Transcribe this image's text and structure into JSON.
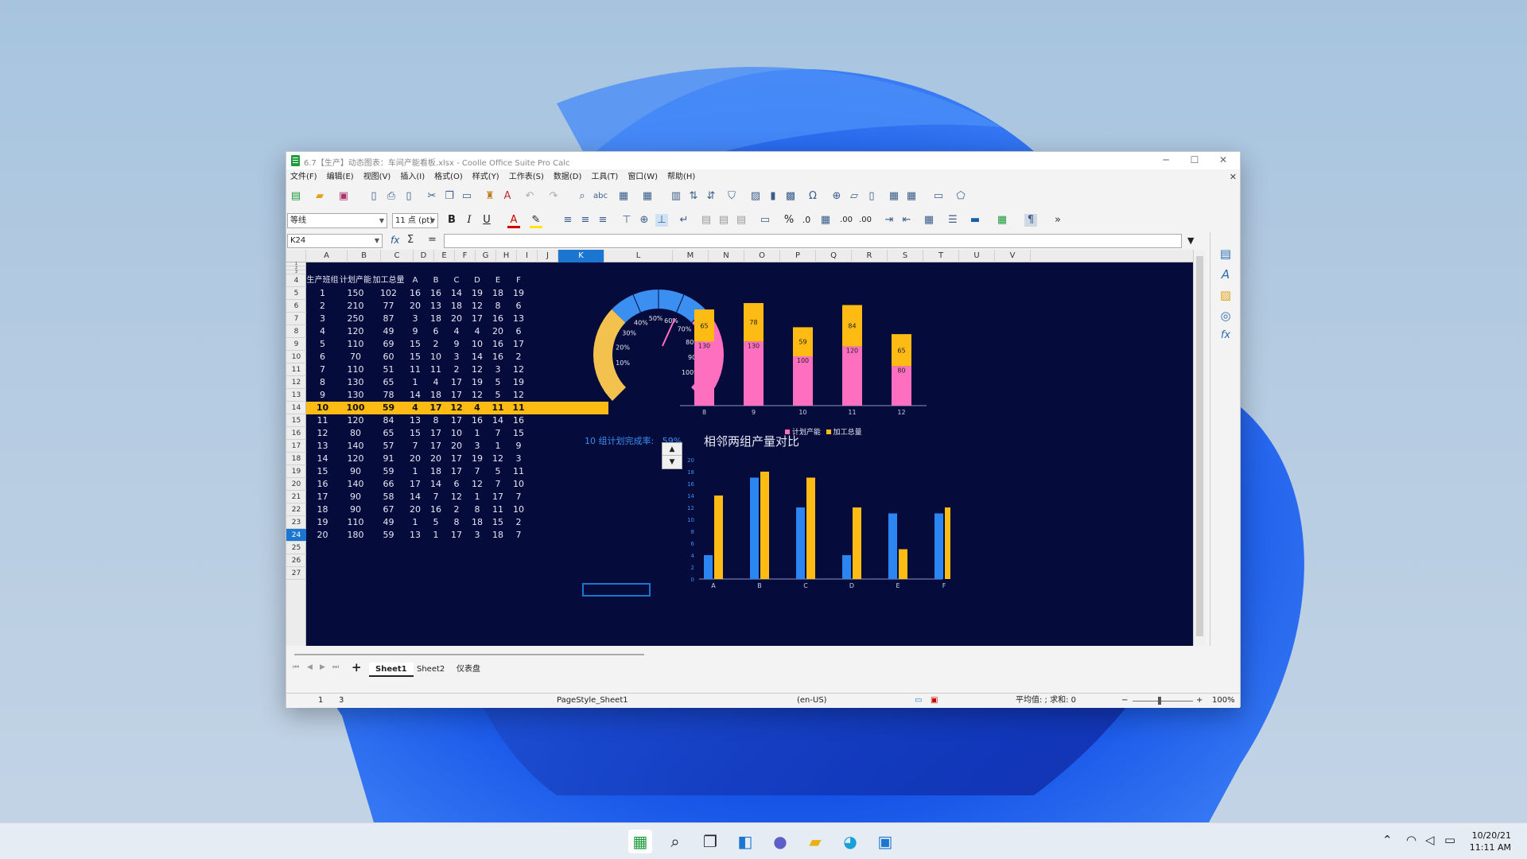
{
  "window": {
    "title": "6.7【生产】动态图表：车间产能看板.xlsx - Coolle Office Suite Pro Calc",
    "menu": [
      "文件(F)",
      "编辑(E)",
      "视图(V)",
      "插入(I)",
      "格式(O)",
      "样式(Y)",
      "工作表(S)",
      "数据(D)",
      "工具(T)",
      "窗口(W)",
      "帮助(H)"
    ]
  },
  "toolbar": {
    "font_name": "等线",
    "font_size": "11 点 (pt)",
    "bold": "B",
    "italic": "I",
    "underline": "U",
    "percent": "%",
    "decimal_zero": ".0",
    "dec_add": ".00",
    "dec_remove": ".00"
  },
  "formula_bar": {
    "name_box": "K24",
    "fx": "fx",
    "sigma": "Σ",
    "equals": "="
  },
  "columns": [
    "A",
    "B",
    "C",
    "D",
    "E",
    "F",
    "G",
    "H",
    "I",
    "J",
    "K",
    "L",
    "M",
    "N",
    "O",
    "P",
    "Q",
    "R",
    "S",
    "T",
    "U",
    "V"
  ],
  "rows": [
    "1",
    "2",
    "3",
    "4",
    "5",
    "6",
    "7",
    "8",
    "9",
    "10",
    "11",
    "12",
    "13",
    "14",
    "15",
    "16",
    "17",
    "18",
    "19",
    "20",
    "21",
    "22",
    "23",
    "24",
    "25",
    "26",
    "27"
  ],
  "table": {
    "header": [
      "生产班组",
      "计划产能",
      "加工总量",
      "A",
      "B",
      "C",
      "D",
      "E",
      "F"
    ],
    "data": [
      [
        "1",
        "150",
        "102",
        "16",
        "16",
        "14",
        "19",
        "18",
        "19"
      ],
      [
        "2",
        "210",
        "77",
        "20",
        "13",
        "18",
        "12",
        "8",
        "6"
      ],
      [
        "3",
        "250",
        "87",
        "3",
        "18",
        "20",
        "17",
        "16",
        "13"
      ],
      [
        "4",
        "120",
        "49",
        "9",
        "6",
        "4",
        "4",
        "20",
        "6"
      ],
      [
        "5",
        "110",
        "69",
        "15",
        "2",
        "9",
        "10",
        "16",
        "17"
      ],
      [
        "6",
        "70",
        "60",
        "15",
        "10",
        "3",
        "14",
        "16",
        "2"
      ],
      [
        "7",
        "110",
        "51",
        "11",
        "11",
        "2",
        "12",
        "3",
        "12"
      ],
      [
        "8",
        "130",
        "65",
        "1",
        "4",
        "17",
        "19",
        "5",
        "19"
      ],
      [
        "9",
        "130",
        "78",
        "14",
        "18",
        "17",
        "12",
        "5",
        "12"
      ],
      [
        "10",
        "100",
        "59",
        "4",
        "17",
        "12",
        "4",
        "11",
        "11"
      ],
      [
        "11",
        "120",
        "84",
        "13",
        "8",
        "17",
        "16",
        "14",
        "16"
      ],
      [
        "12",
        "80",
        "65",
        "15",
        "17",
        "10",
        "1",
        "7",
        "15"
      ],
      [
        "13",
        "140",
        "57",
        "7",
        "17",
        "20",
        "3",
        "1",
        "9"
      ],
      [
        "14",
        "120",
        "91",
        "20",
        "20",
        "17",
        "19",
        "12",
        "3"
      ],
      [
        "15",
        "90",
        "59",
        "1",
        "18",
        "17",
        "7",
        "5",
        "11"
      ],
      [
        "16",
        "140",
        "66",
        "17",
        "14",
        "6",
        "12",
        "7",
        "10"
      ],
      [
        "17",
        "90",
        "58",
        "14",
        "7",
        "12",
        "1",
        "17",
        "7"
      ],
      [
        "18",
        "90",
        "67",
        "20",
        "16",
        "2",
        "8",
        "11",
        "10"
      ],
      [
        "19",
        "110",
        "49",
        "1",
        "5",
        "8",
        "18",
        "15",
        "2"
      ],
      [
        "20",
        "180",
        "59",
        "13",
        "1",
        "17",
        "3",
        "18",
        "7"
      ]
    ],
    "highlighted_group": "10"
  },
  "chart_data": [
    {
      "type": "gauge",
      "title": "10 组计划完成率:   59%",
      "value": 0.59,
      "tick_labels": [
        "10%",
        "20%",
        "30%",
        "40%",
        "50%",
        "60%",
        "70%",
        "80%",
        "90%",
        "100%"
      ],
      "colors": {
        "low": "#f2c14e",
        "mid": "#3a8ff0",
        "high": "#ff6fc0"
      }
    },
    {
      "type": "bar",
      "stacked": true,
      "categories": [
        "8",
        "9",
        "10",
        "11",
        "12"
      ],
      "series": [
        {
          "name": "计划产能",
          "values": [
            130,
            130,
            100,
            120,
            80
          ],
          "color": "#ff6fc0"
        },
        {
          "name": "加工总量",
          "values": [
            65,
            78,
            59,
            84,
            65
          ],
          "color": "#fdbb14"
        }
      ]
    },
    {
      "type": "bar",
      "title": "相邻两组产量对比",
      "categories": [
        "A",
        "B",
        "C",
        "D",
        "E",
        "F"
      ],
      "series": [
        {
          "values": [
            4,
            17,
            12,
            4,
            11,
            11
          ],
          "color": "#2c86f2"
        },
        {
          "values": [
            14,
            18,
            17,
            12,
            5,
            12
          ],
          "color": "#fdbb14"
        }
      ],
      "y_ticks": [
        "0",
        "2",
        "4",
        "6",
        "8",
        "10",
        "12",
        "14",
        "16",
        "18",
        "20"
      ],
      "ylim": [
        0,
        20
      ]
    }
  ],
  "sheet_tabs": [
    "Sheet1",
    "Sheet2",
    "仪表盘"
  ],
  "status": {
    "sheet_pos": "1",
    "sheet_count": "3",
    "page_style": "PageStyle_Sheet1",
    "lang": "(en-US)",
    "sum": "平均值: ; 求和: 0",
    "zoom": "100%"
  },
  "taskbar": {
    "date": "10/20/21",
    "time": "11:11 AM"
  }
}
